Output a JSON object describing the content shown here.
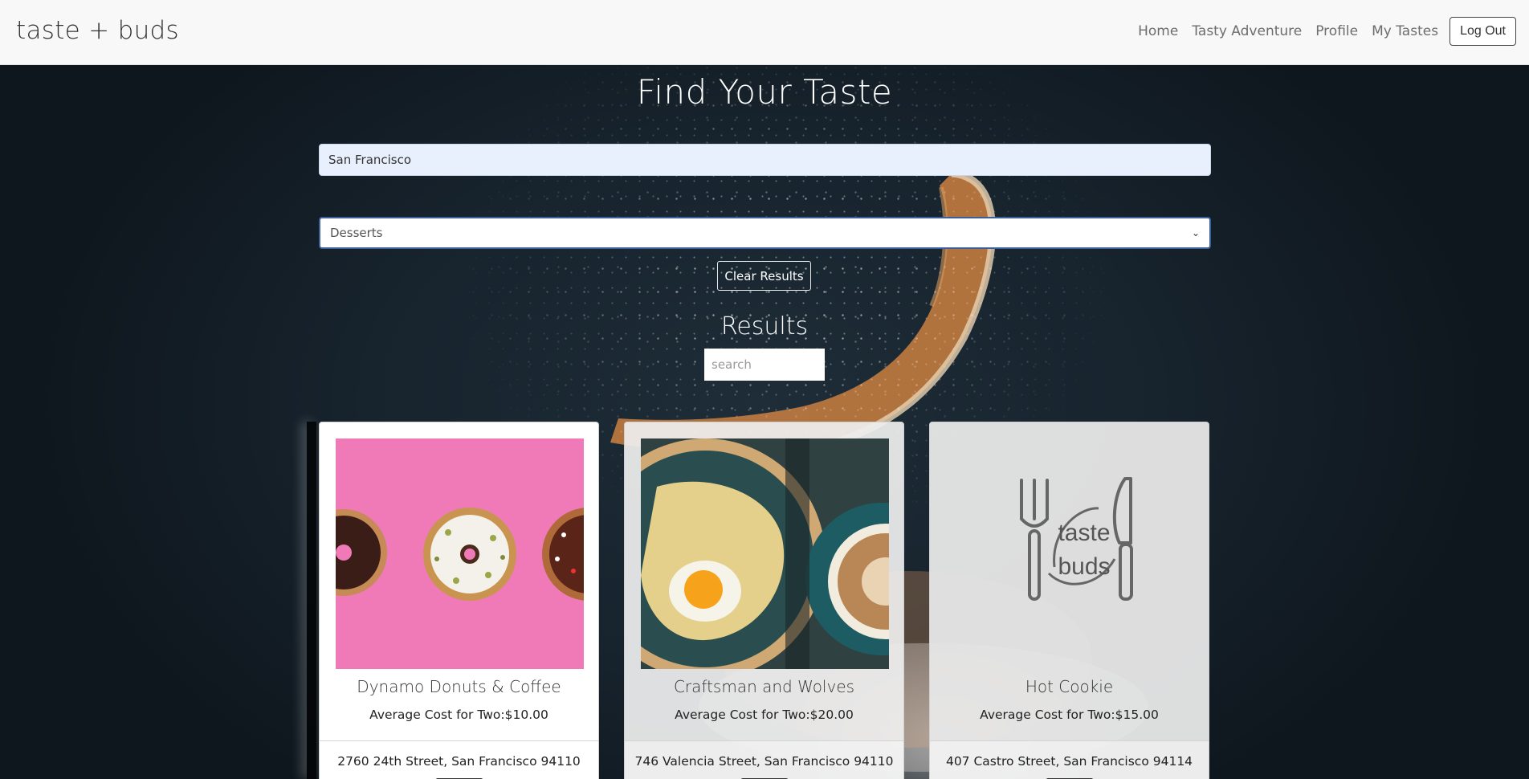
{
  "navbar": {
    "brand": "taste + buds",
    "links": [
      "Home",
      "Tasty Adventure",
      "Profile",
      "My Tastes"
    ],
    "logout_label": "Log Out"
  },
  "hero": {
    "title": "Find Your Taste",
    "city_value": "San Francisco",
    "category_value": "Desserts",
    "clear_label": "Clear Results",
    "results_title": "Results",
    "search_placeholder": "search"
  },
  "cards": [
    {
      "name": "Dynamo Donuts & Coffee",
      "cost_label": "Average Cost for Two:$10.00",
      "address": "2760 24th Street, San Francisco 94110",
      "image": "donuts-photo"
    },
    {
      "name": "Craftsman and Wolves",
      "cost_label": "Average Cost for Two:$20.00",
      "address": "746 Valencia Street, San Francisco 94110",
      "image": "egg-coffee-photo"
    },
    {
      "name": "Hot Cookie",
      "cost_label": "Average Cost for Two:$15.00",
      "address": "407 Castro Street, San Francisco 94114",
      "image": "taste-buds-logo",
      "logo_text": [
        "taste",
        "buds"
      ]
    }
  ],
  "colors": {
    "navbar_bg": "#f8f8f9",
    "hero_bg": "#17232d",
    "input_bg": "#e8f0fe",
    "select_border": "#3b5f9c",
    "donut_bg": "#f07ab8"
  }
}
